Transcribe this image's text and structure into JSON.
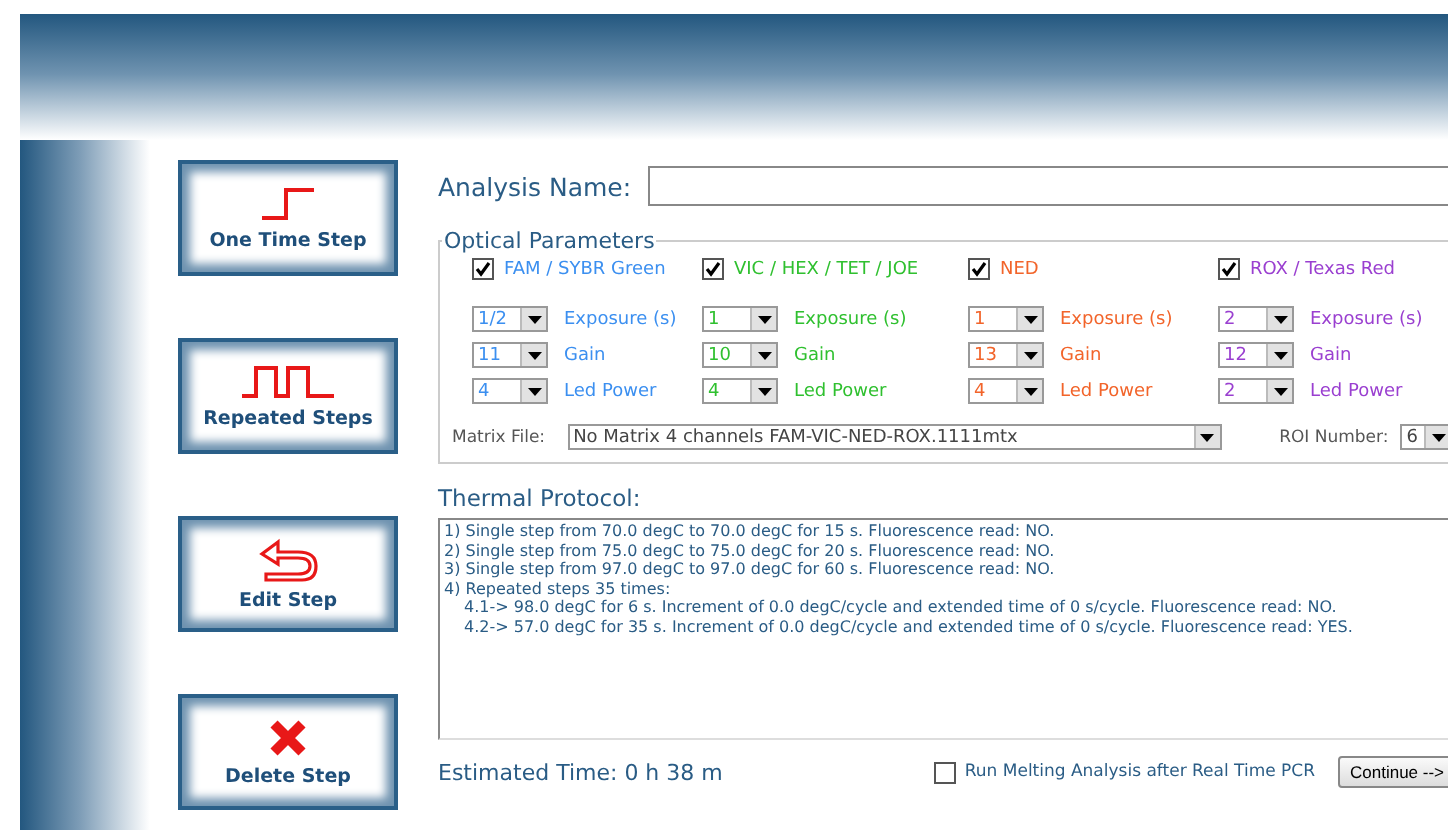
{
  "step_buttons": [
    {
      "kind": "single",
      "label": "One Time Step"
    },
    {
      "kind": "repeat",
      "label": "Repeated Steps"
    },
    {
      "kind": "edit",
      "label": "Edit Step"
    },
    {
      "kind": "delete",
      "label": "Delete Step"
    }
  ],
  "analysis_name": {
    "label": "Analysis Name:"
  },
  "optical_parameters": {
    "title": "Optical Parameters",
    "channels": [
      {
        "name": "FAM / SYBR Green",
        "color": "#3b8ff0",
        "checked": true,
        "exposure": "1/2",
        "exposure_label": "Exposure (s)",
        "gain": "11",
        "gain_label": "Gain",
        "led_power": "4",
        "led_power_label": "Led Power"
      },
      {
        "name": "VIC / HEX / TET / JOE",
        "color": "#2fc02f",
        "checked": true,
        "exposure": "1",
        "exposure_label": "Exposure (s)",
        "gain": "10",
        "gain_label": "Gain",
        "led_power": "4",
        "led_power_label": "Led Power"
      },
      {
        "name": "NED",
        "color": "#f2642a",
        "checked": true,
        "exposure": "1",
        "exposure_label": "Exposure (s)",
        "gain": "13",
        "gain_label": "Gain",
        "led_power": "4",
        "led_power_label": "Led Power"
      },
      {
        "name": "ROX / Texas Red",
        "color": "#9a3fd0",
        "checked": true,
        "exposure": "2",
        "exposure_label": "Exposure (s)",
        "gain": "12",
        "gain_label": "Gain",
        "led_power": "2",
        "led_power_label": "Led Power"
      }
    ],
    "matrix_file": {
      "label": "Matrix File:",
      "value": "No Matrix 4 channels FAM-VIC-NED-ROX.1111mtx"
    },
    "roi_number": {
      "label": "ROI Number:",
      "value": "6"
    }
  },
  "thermal_protocol": {
    "label": "Thermal Protocol:",
    "lines": [
      {
        "text": "1) Single step from 70.0 degC to 70.0 degC for 15 s. Fluorescence read: NO."
      },
      {
        "text": "2) Single step from 75.0 degC to 75.0 degC for 20 s. Fluorescence read: NO."
      },
      {
        "text": "3) Single step from 97.0 degC to 97.0 degC for 60 s. Fluorescence read: NO."
      },
      {
        "text": "4) Repeated steps 35 times:",
        "children": [
          {
            "text": "4.1-> 98.0 degC for 6 s. Increment of  0.0 degC/cycle and extended time of 0 s/cycle. Fluorescence read: NO."
          },
          {
            "text": "4.2-> 57.0 degC for 35 s. Increment of  0.0 degC/cycle and extended time of 0 s/cycle. Fluorescence read: YES."
          }
        ]
      }
    ]
  },
  "estimated_time": "Estimated Time: 0 h 38 m",
  "melting_analysis": {
    "label": "Run Melting Analysis after Real Time PCR",
    "checked": false
  },
  "continue_button": "Continue -->"
}
